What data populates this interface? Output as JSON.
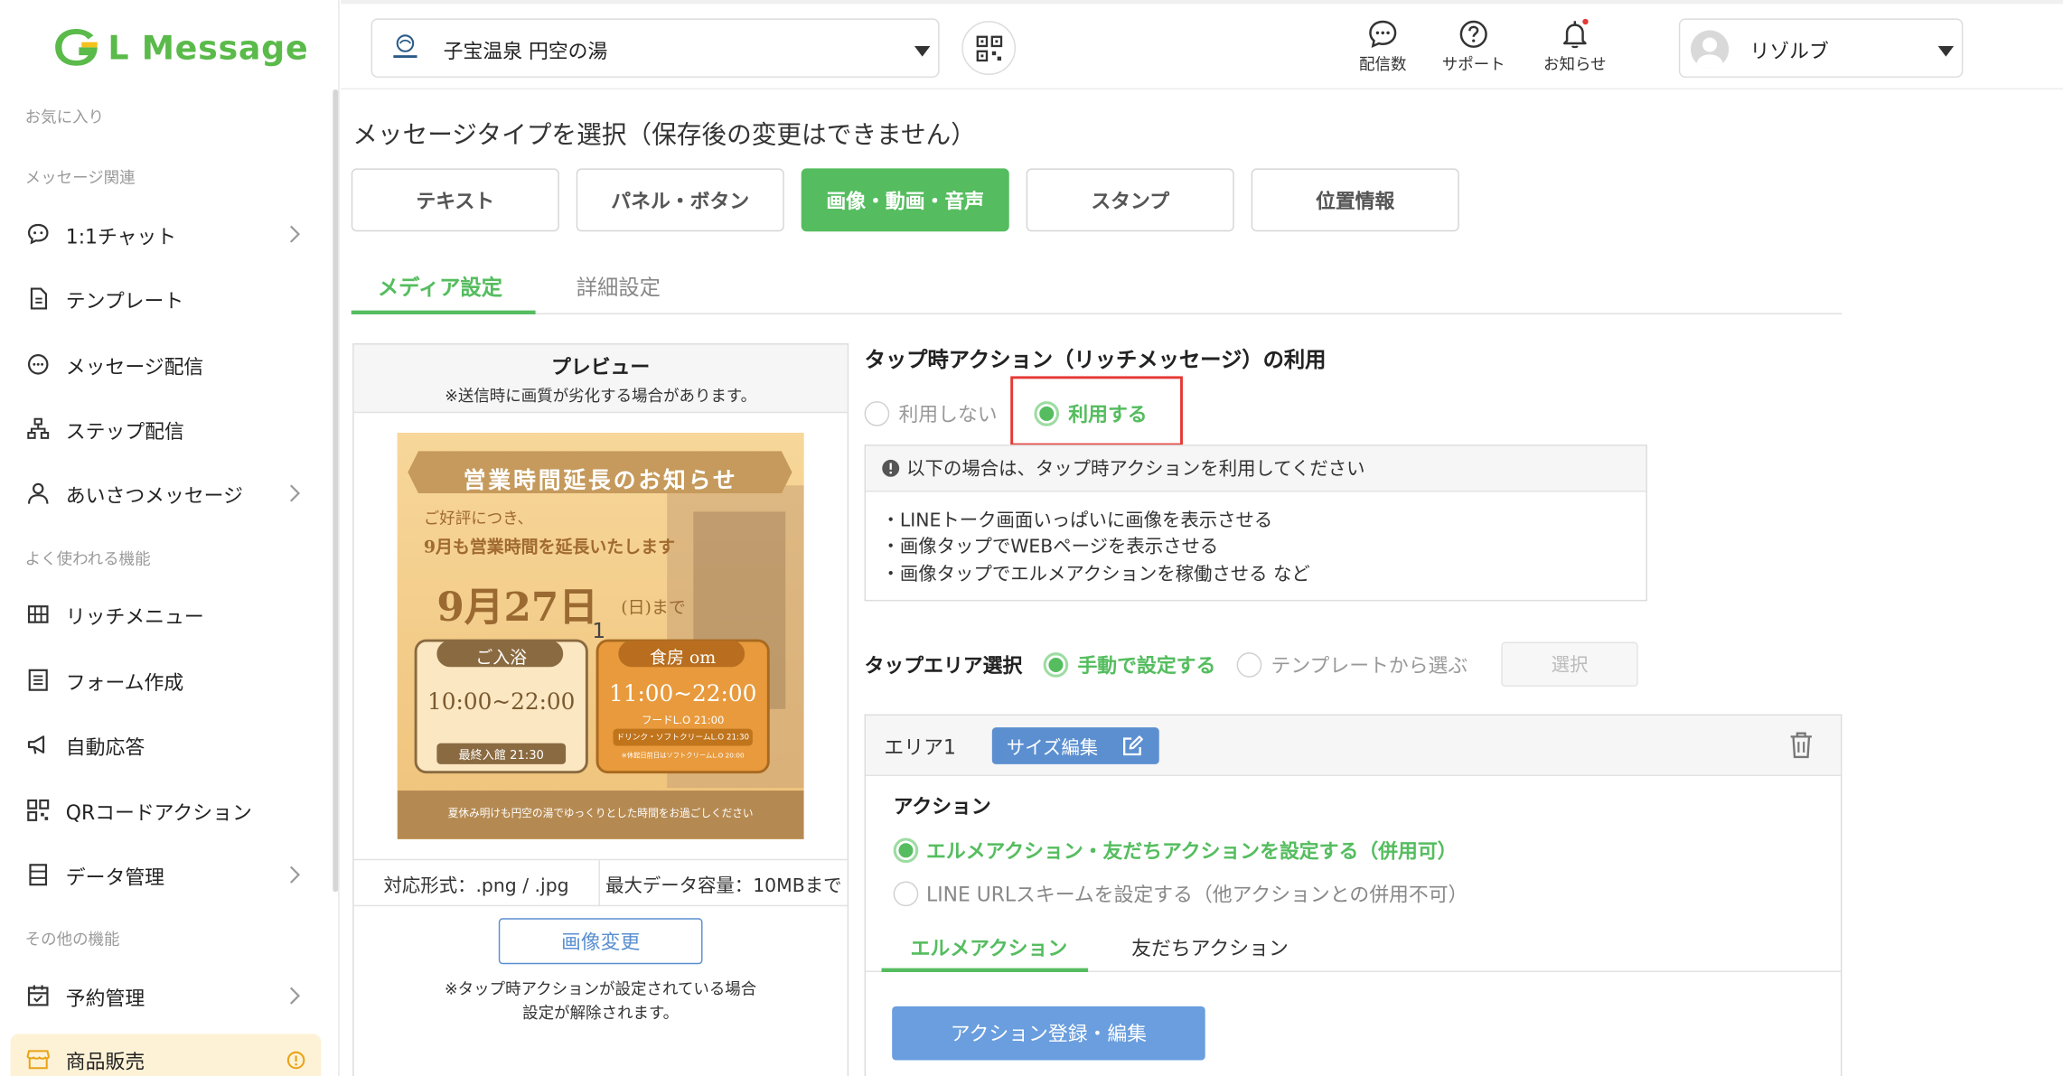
{
  "sidebar": {
    "logo_text": "L Message",
    "sections": {
      "favorites": "お気に入り",
      "message": "メッセージ関連",
      "frequent": "よく使われる機能",
      "other": "その他の機能"
    },
    "items": [
      {
        "label": "1:1チャット"
      },
      {
        "label": "テンプレート"
      },
      {
        "label": "メッセージ配信"
      },
      {
        "label": "ステップ配信"
      },
      {
        "label": "あいさつメッセージ"
      },
      {
        "label": "リッチメニュー"
      },
      {
        "label": "フォーム作成"
      },
      {
        "label": "自動応答"
      },
      {
        "label": "QRコードアクション"
      },
      {
        "label": "データ管理"
      },
      {
        "label": "予約管理"
      },
      {
        "label": "商品販売"
      }
    ]
  },
  "header": {
    "account_name": "子宝温泉 円空の湯",
    "buttons": {
      "delivery_count": "配信数",
      "support": "サポート",
      "notice": "お知らせ"
    },
    "user_name": "リゾルブ"
  },
  "main": {
    "title": "メッセージタイプを選択（保存後の変更はできません）",
    "type_buttons": [
      "テキスト",
      "パネル・ボタン",
      "画像・動画・音声",
      "スタンプ",
      "位置情報"
    ],
    "selected_type": "画像・動画・音声",
    "sub_tabs": [
      "メディア設定",
      "詳細設定"
    ],
    "preview": {
      "title": "プレビュー",
      "subtitle": "※送信時に画質が劣化する場合があります。",
      "poster": {
        "headline": "営業時間延長のお知らせ",
        "line1": "ご好評につき、",
        "line2": "9月も営業時間を延長いたします",
        "date_big": "9月27日",
        "date_small": "(日)まで",
        "bath_label": "ご入浴",
        "bath_hours": "10:00~22:00",
        "bath_last": "最終入館 21:30",
        "dining_label": "食房 om",
        "dining_hours": "11:00~22:00",
        "dining_lo": "フードL.O 21:00",
        "dining_lo2": "ドリンク・ソフトクリームL.O 21:30",
        "dining_note": "※休館日前日はソフトクリームL.O 20:00",
        "area_number": "1",
        "footer": "夏休み明けも円空の湯でゆっくりとした時間をお過ごしください"
      },
      "format": "対応形式：.png / .jpg",
      "max_size": "最大データ容量：10MBまで",
      "change_button": "画像変更",
      "note_line1": "※タップ時アクションが設定されている場合",
      "note_line2": "設定が解除されます。"
    },
    "tap_action": {
      "heading": "タップ時アクション（リッチメッセージ）の利用",
      "option_off": "利用しない",
      "option_on": "利用する",
      "info_header": "以下の場合は、タップ時アクションを利用してください",
      "info_items": [
        "・LINEトーク画面いっぱいに画像を表示させる",
        "・画像タップでWEBページを表示させる",
        "・画像タップでエルメアクションを稼働させる など"
      ],
      "area_select_label": "タップエリア選択",
      "area_manual": "手動で設定する",
      "area_template": "テンプレートから選ぶ",
      "select_button": "選択"
    },
    "area": {
      "name": "エリア1",
      "size_edit": "サイズ編集",
      "action_label": "アクション",
      "action_opt1": "エルメアクション・友だちアクションを設定する（併用可）",
      "action_opt2": "LINE URLスキームを設定する（他アクションとの併用不可）",
      "tabs": [
        "エルメアクション",
        "友だちアクション"
      ],
      "register_button": "アクション登録・編集"
    }
  },
  "colors": {
    "accent": "#55bd5f",
    "blue": "#5b8fd0",
    "highlight": "#e53935",
    "active_bg": "#fdf2d6"
  }
}
